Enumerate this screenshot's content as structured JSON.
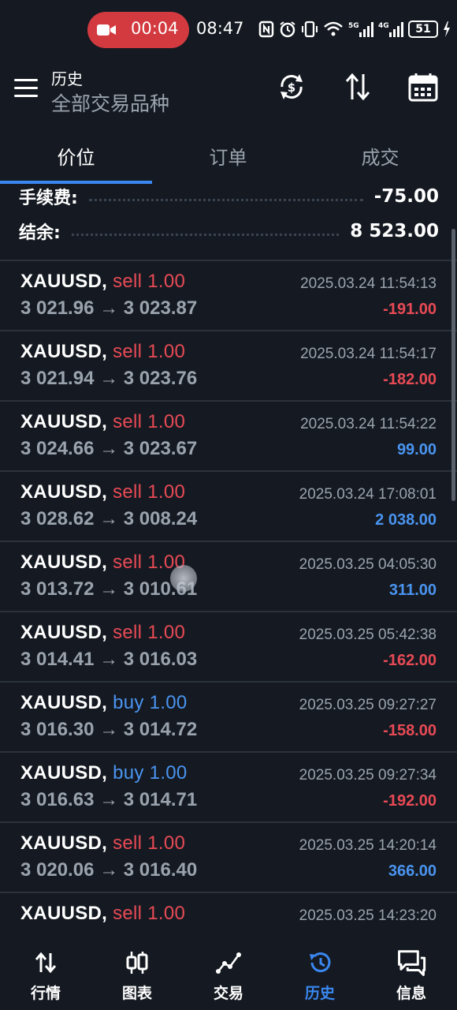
{
  "status_bar": {
    "rec_time": "00:04",
    "clock": "08:47",
    "battery": "51"
  },
  "header": {
    "title": "历史",
    "subtitle": "全部交易品种"
  },
  "tabs": [
    "价位",
    "订单",
    "成交"
  ],
  "active_tab": 0,
  "summary": {
    "fee_label": "手续费:",
    "fee_value": "-75.00",
    "balance_label": "结余:",
    "balance_value": "8 523.00"
  },
  "deals": [
    {
      "symbol": "XAUUSD,",
      "side": "sell",
      "volume": "1.00",
      "prices": "3 021.96 → 3 023.87",
      "time": "2025.03.24 11:54:13",
      "profit": "-191.00"
    },
    {
      "symbol": "XAUUSD,",
      "side": "sell",
      "volume": "1.00",
      "prices": "3 021.94 → 3 023.76",
      "time": "2025.03.24 11:54:17",
      "profit": "-182.00"
    },
    {
      "symbol": "XAUUSD,",
      "side": "sell",
      "volume": "1.00",
      "prices": "3 024.66 → 3 023.67",
      "time": "2025.03.24 11:54:22",
      "profit": "99.00"
    },
    {
      "symbol": "XAUUSD,",
      "side": "sell",
      "volume": "1.00",
      "prices": "3 028.62 → 3 008.24",
      "time": "2025.03.24 17:08:01",
      "profit": "2 038.00"
    },
    {
      "symbol": "XAUUSD,",
      "side": "sell",
      "volume": "1.00",
      "prices": "3 013.72 → 3 010.61",
      "time": "2025.03.25 04:05:30",
      "profit": "311.00"
    },
    {
      "symbol": "XAUUSD,",
      "side": "sell",
      "volume": "1.00",
      "prices": "3 014.41 → 3 016.03",
      "time": "2025.03.25 05:42:38",
      "profit": "-162.00"
    },
    {
      "symbol": "XAUUSD,",
      "side": "buy",
      "volume": "1.00",
      "prices": "3 016.30 → 3 014.72",
      "time": "2025.03.25 09:27:27",
      "profit": "-158.00"
    },
    {
      "symbol": "XAUUSD,",
      "side": "buy",
      "volume": "1.00",
      "prices": "3 016.63 → 3 014.71",
      "time": "2025.03.25 09:27:34",
      "profit": "-192.00"
    },
    {
      "symbol": "XAUUSD,",
      "side": "sell",
      "volume": "1.00",
      "prices": "3 020.06 → 3 016.40",
      "time": "2025.03.25 14:20:14",
      "profit": "366.00"
    },
    {
      "symbol": "XAUUSD,",
      "side": "sell",
      "volume": "1.00",
      "prices": "",
      "time": "2025.03.25 14:23:20",
      "profit": ""
    }
  ],
  "bottom_nav": [
    {
      "label": "行情",
      "icon": "quotes-icon"
    },
    {
      "label": "图表",
      "icon": "chart-icon"
    },
    {
      "label": "交易",
      "icon": "trade-icon"
    },
    {
      "label": "历史",
      "icon": "history-icon"
    },
    {
      "label": "信息",
      "icon": "messages-icon"
    }
  ],
  "active_nav": 3,
  "colors": {
    "background": "#151a22",
    "accent": "#3a87f0",
    "sell": "#e84a55",
    "buy": "#4a94f0",
    "muted": "#9aa3ad"
  }
}
